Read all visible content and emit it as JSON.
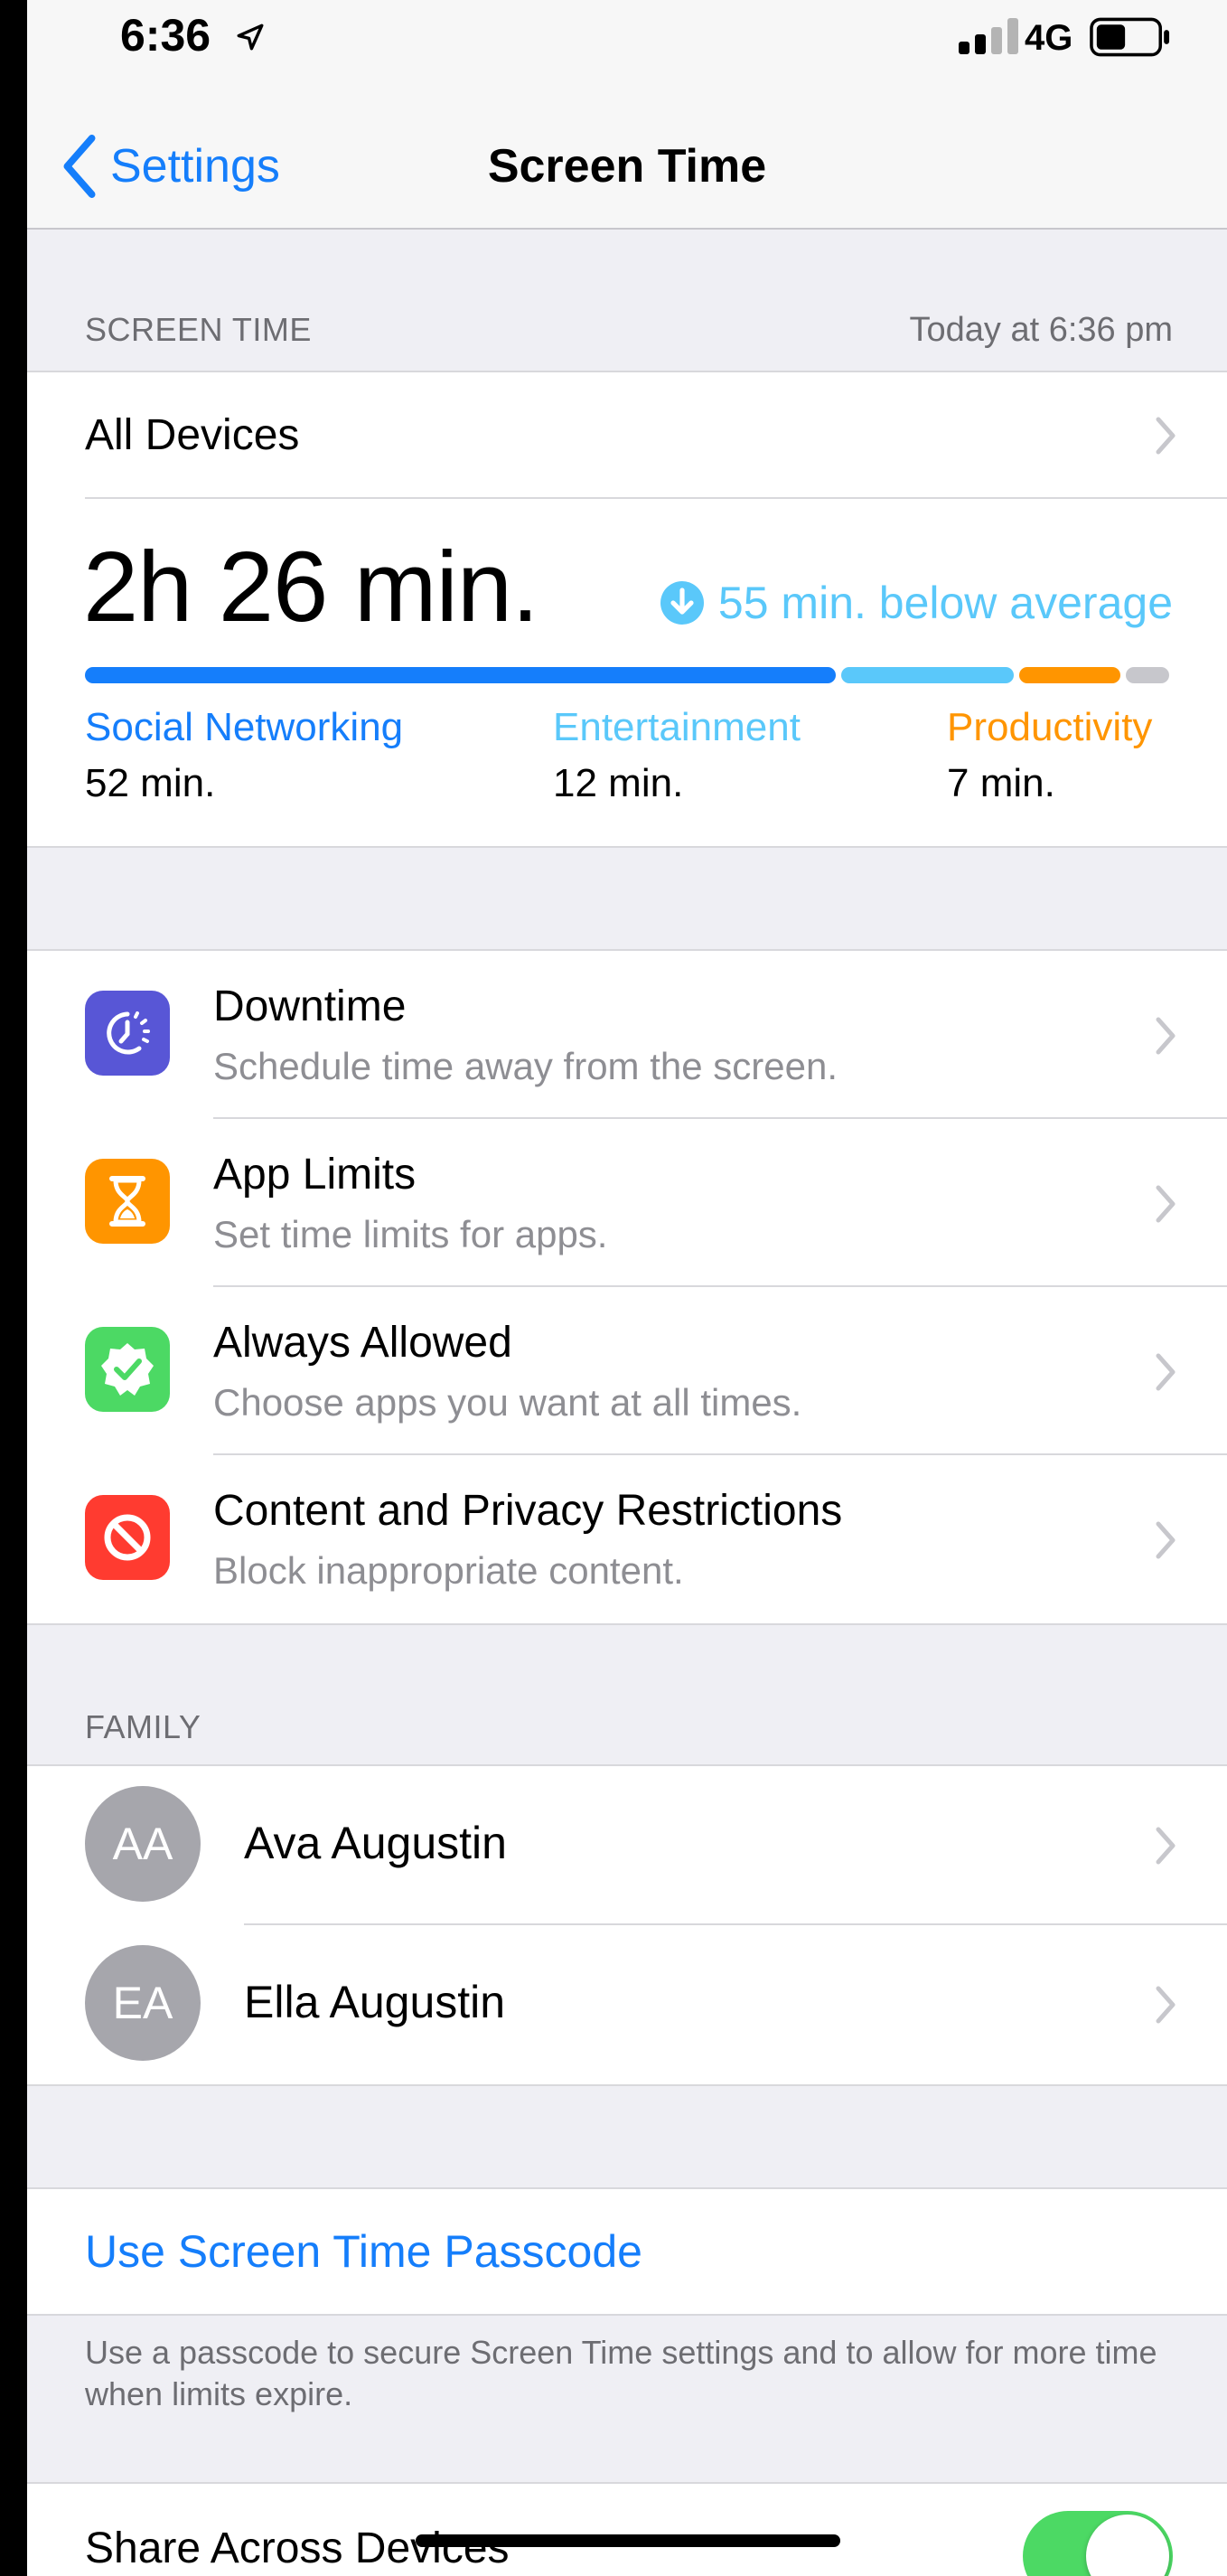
{
  "status": {
    "time": "6:36",
    "network": "4G"
  },
  "nav": {
    "back_label": "Settings",
    "title": "Screen Time"
  },
  "screen_time_header": {
    "label": "SCREEN TIME",
    "updated": "Today at 6:36 pm"
  },
  "summary": {
    "devices_label": "All Devices",
    "total": "2h 26 min.",
    "comparison": "55 min. below average",
    "usage_bar": [
      {
        "category": "Social Networking",
        "minutes": 52,
        "color": "#157efb"
      },
      {
        "category": "Entertainment",
        "minutes": 12,
        "color": "#5ac8fa"
      },
      {
        "category": "Productivity",
        "minutes": 7,
        "color": "#ff9500"
      },
      {
        "category": "Other",
        "minutes": 3,
        "color": "#c7c7cc"
      }
    ],
    "categories": [
      {
        "name": "Social Networking",
        "value": "52 min.",
        "color": "#157efb"
      },
      {
        "name": "Entertainment",
        "value": "12 min.",
        "color": "#5ac8fa"
      },
      {
        "name": "Productivity",
        "value": "7 min.",
        "color": "#ff9500"
      }
    ]
  },
  "menu": [
    {
      "title": "Downtime",
      "subtitle": "Schedule time away from the screen.",
      "icon": "downtime-icon",
      "color": "#5856d6"
    },
    {
      "title": "App Limits",
      "subtitle": "Set time limits for apps.",
      "icon": "hourglass-icon",
      "color": "#ff9500"
    },
    {
      "title": "Always Allowed",
      "subtitle": "Choose apps you want at all times.",
      "icon": "checkmark-badge-icon",
      "color": "#4cd964"
    },
    {
      "title": "Content and Privacy Restrictions",
      "subtitle": "Block inappropriate content.",
      "icon": "restricted-icon",
      "color": "#ff3b30"
    }
  ],
  "family": {
    "label": "FAMILY",
    "members": [
      {
        "initials": "AA",
        "name": "Ava Augustin"
      },
      {
        "initials": "EA",
        "name": "Ella Augustin"
      }
    ]
  },
  "passcode": {
    "link": "Use Screen Time Passcode",
    "footnote": "Use a passcode to secure Screen Time settings and to allow for more time when limits expire."
  },
  "share": {
    "label": "Share Across Devices",
    "enabled": true
  }
}
